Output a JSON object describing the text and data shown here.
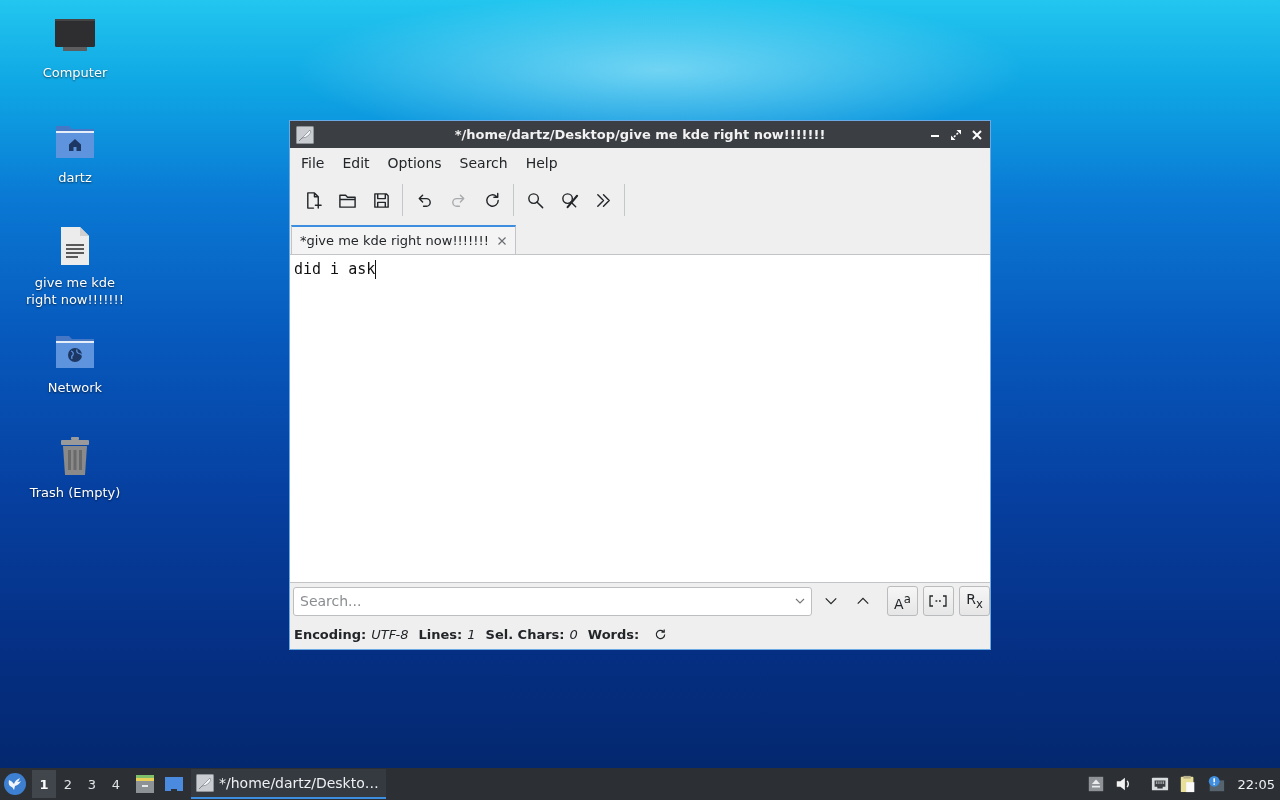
{
  "desktop_icons": [
    {
      "kind": "computer",
      "label": "Computer"
    },
    {
      "kind": "home",
      "label": "dartz"
    },
    {
      "kind": "document",
      "label": "give me kde right now!!!!!!!"
    },
    {
      "kind": "network",
      "label": "Network"
    },
    {
      "kind": "trash",
      "label": "Trash (Empty)"
    }
  ],
  "window": {
    "title": "*/home/dartz/Desktop/give me kde right now!!!!!!!"
  },
  "menu": [
    "File",
    "Edit",
    "Options",
    "Search",
    "Help"
  ],
  "toolbar": [
    {
      "buttons": [
        {
          "kind": "new",
          "disabled": false
        },
        {
          "kind": "open",
          "disabled": false
        },
        {
          "kind": "save",
          "disabled": false
        }
      ]
    },
    {
      "buttons": [
        {
          "kind": "undo",
          "disabled": false
        },
        {
          "kind": "redo",
          "disabled": true
        },
        {
          "kind": "reload",
          "disabled": false
        }
      ]
    },
    {
      "buttons": [
        {
          "kind": "find",
          "disabled": false
        },
        {
          "kind": "replace",
          "disabled": false
        },
        {
          "kind": "more",
          "disabled": false
        }
      ]
    }
  ],
  "tabs": [
    {
      "label": "*give me kde right now!!!!!!!",
      "selected": true
    }
  ],
  "editor": {
    "text": "did i ask"
  },
  "search": {
    "placeholder": "Search...",
    "options": [
      {
        "kind": "match-case",
        "label": "A$^{a}$"
      },
      {
        "kind": "whole-word"
      },
      {
        "kind": "regex",
        "label": "R$_{x}$"
      }
    ]
  },
  "status_bar": [
    {
      "kind": "text",
      "label": "Encoding:",
      "value": "UTF-8"
    },
    {
      "kind": "text",
      "label": "Lines:",
      "value": "1"
    },
    {
      "kind": "text",
      "label": "Sel. Chars:",
      "value": "0"
    },
    {
      "kind": "refresh",
      "label": "Words:"
    }
  ],
  "taskbar": {
    "workspaces": [
      {
        "label": "1",
        "selected": true
      },
      {
        "label": "2",
        "selected": false
      },
      {
        "label": "3",
        "selected": false
      },
      {
        "label": "4",
        "selected": false
      }
    ],
    "launchers": [
      {
        "kind": "file-manager"
      },
      {
        "kind": "desktop"
      }
    ],
    "tasks": [
      {
        "label": "*/home/dartz/Deskto…",
        "selected": true
      }
    ],
    "tray": [
      {
        "kind": "eject"
      },
      {
        "kind": "volume"
      },
      {
        "kind": "network"
      },
      {
        "kind": "clipboard"
      },
      {
        "kind": "notification"
      }
    ],
    "clock": "22:05"
  }
}
